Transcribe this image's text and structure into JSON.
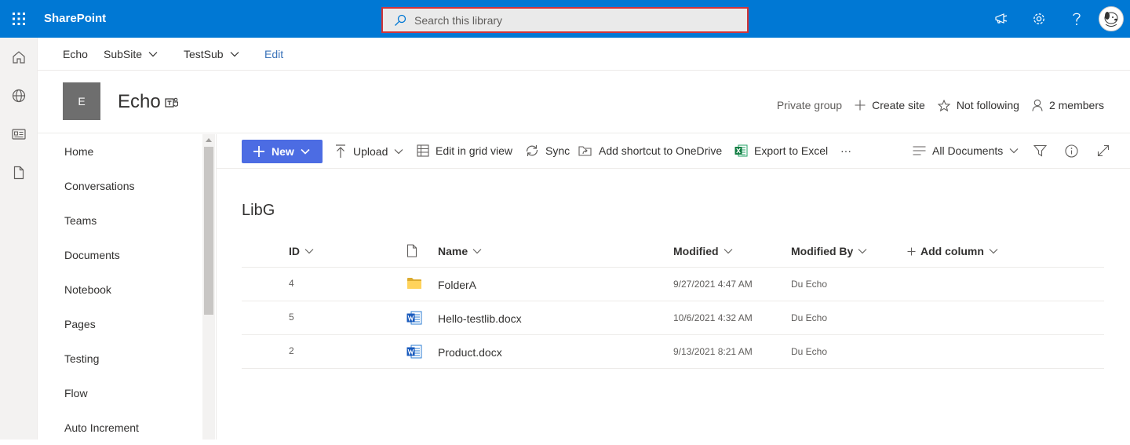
{
  "suite": {
    "brand": "SharePoint",
    "search_placeholder": "Search this library"
  },
  "hubnav": {
    "items": [
      "Echo",
      "SubSite",
      "TestSub"
    ],
    "edit": "Edit"
  },
  "site": {
    "logo_letter": "E",
    "title": "Echo",
    "privacy": "Private group",
    "create_site": "Create site",
    "follow": "Not following",
    "members": "2 members"
  },
  "leftnav": {
    "items": [
      "Home",
      "Conversations",
      "Teams",
      "Documents",
      "Notebook",
      "Pages",
      "Testing",
      "Flow",
      "Auto Increment"
    ]
  },
  "commandbar": {
    "new": "New",
    "upload": "Upload",
    "edit_grid": "Edit in grid view",
    "sync": "Sync",
    "add_shortcut": "Add shortcut to OneDrive",
    "export": "Export to Excel",
    "more": "···",
    "view": "All Documents"
  },
  "library": {
    "title": "LibG",
    "columns": {
      "id": "ID",
      "name": "Name",
      "modified": "Modified",
      "modified_by": "Modified By",
      "add_column": "Add column"
    },
    "rows": [
      {
        "id": "4",
        "type": "folder",
        "name": "FolderA",
        "modified": "9/27/2021 4:47 AM",
        "modified_by": "Du Echo"
      },
      {
        "id": "5",
        "type": "word",
        "name": "Hello-testlib.docx",
        "modified": "10/6/2021 4:32 AM",
        "modified_by": "Du Echo"
      },
      {
        "id": "2",
        "type": "word",
        "name": "Product.docx",
        "modified": "9/13/2021 8:21 AM",
        "modified_by": "Du Echo"
      }
    ]
  },
  "colors": {
    "suite_bar": "#0078d4",
    "new_button": "#4c6ce3",
    "search_border": "#d13438"
  }
}
